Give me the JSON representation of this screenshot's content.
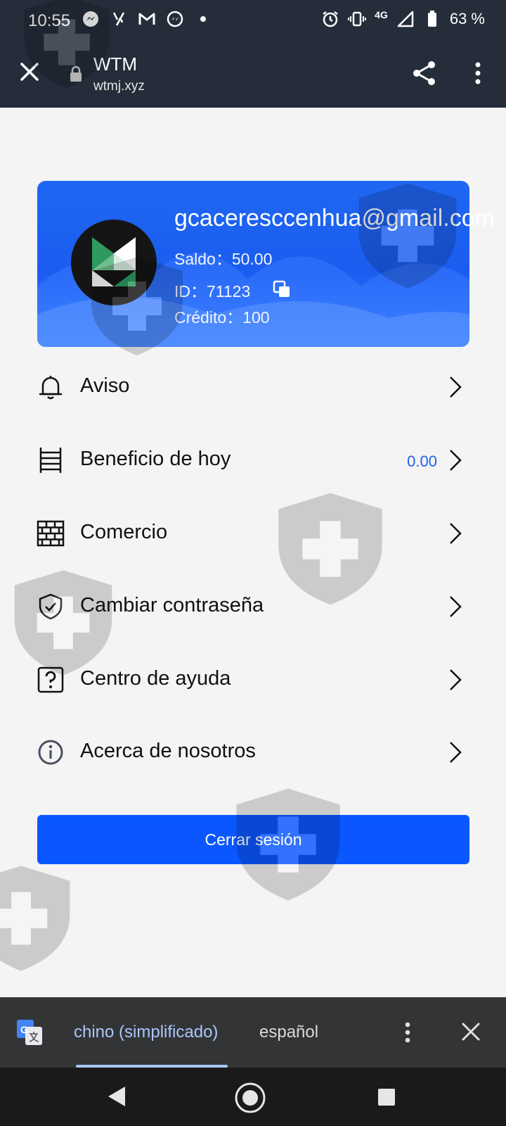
{
  "status_bar": {
    "time": "10:55",
    "network": "4G",
    "battery": "63 %"
  },
  "browser": {
    "title": "WTM",
    "url": "wtmj.xyz"
  },
  "profile": {
    "email": "gcaceresccenhua@gmail.com",
    "saldo_label": "Saldo：",
    "saldo_value": "50.00",
    "id_label": "ID：",
    "id_value": "71123",
    "credito_label": "Crédito：",
    "credito_value": "100"
  },
  "menu": {
    "items": [
      {
        "label": "Aviso",
        "icon": "bell-icon"
      },
      {
        "label": "Beneficio de hoy",
        "icon": "ladder-icon",
        "value": "0.00"
      },
      {
        "label": "Comercio",
        "icon": "brick-wall-icon"
      },
      {
        "label": "Cambiar contraseña",
        "icon": "shield-check-icon"
      },
      {
        "label": "Centro de ayuda",
        "icon": "help-box-icon"
      },
      {
        "label": "Acerca de nosotros",
        "icon": "info-circle-icon"
      }
    ]
  },
  "logout": {
    "label": "Cerrar sesión"
  },
  "translate_bar": {
    "source_language": "chino (simplificado)",
    "target_language": "español"
  },
  "colors": {
    "accent": "#0a57ff",
    "card_blue": "#1b5cf0",
    "value_blue": "#1e5ff0",
    "topbar": "#262d3a",
    "translate_active": "#a9c7fa"
  }
}
